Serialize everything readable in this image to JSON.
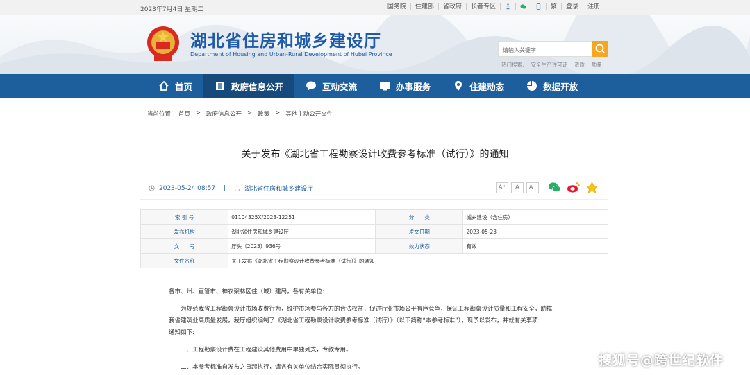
{
  "topbar": {
    "date": "2023年7月4日 星期二",
    "links": [
      "国务院",
      "住建部",
      "省政府",
      "长者专区"
    ],
    "icons": [
      "accessibility-icon",
      "wechat-icon",
      "mobile-icon"
    ],
    "lang": "繁",
    "login": "登录",
    "register": "注册"
  },
  "header": {
    "title": "湖北省住房和城乡建设厅",
    "subtitle": "Department of Housing and Urban-Rural Development of Hubei Province",
    "search_placeholder": "请输入关键字",
    "hot_label": "热门搜索:",
    "hot_items": [
      "安全生产许可证",
      "资质",
      "质量"
    ]
  },
  "nav": {
    "items": [
      {
        "label": "首页",
        "icon": "home-icon"
      },
      {
        "label": "政府信息公开",
        "icon": "document-icon",
        "active": true
      },
      {
        "label": "互动交流",
        "icon": "chat-icon"
      },
      {
        "label": "办事服务",
        "icon": "monitor-icon"
      },
      {
        "label": "住建动态",
        "icon": "location-icon"
      },
      {
        "label": "数据开放",
        "icon": "pie-chart-icon"
      }
    ]
  },
  "breadcrumb": {
    "label": "当前位置:",
    "items": [
      "首页",
      "政府信息公开",
      "政策",
      "其他主动公开文件"
    ],
    "sep": ">"
  },
  "article": {
    "title": "关于发布《湖北省工程勘察设计收费参考标准（试行）》的通知",
    "datetime": "2023-05-24 08:57",
    "sep": "|",
    "source": "湖北省住房和城乡建设厅",
    "font_buttons": [
      "A⁺",
      "A",
      "A⁻"
    ],
    "share_icons": [
      "wechat-share-icon",
      "weibo-share-icon",
      "favorite-star-icon"
    ]
  },
  "info_table": {
    "rows": [
      {
        "k1": "索 引 号",
        "v1": "01104325X/2023-12251",
        "k2": "分　　类",
        "v2": "城乡建设（含住房）"
      },
      {
        "k1": "发布机构",
        "v1": "湖北省住房和城乡建设厅",
        "k2": "发文日期",
        "v2": "2023-05-23"
      },
      {
        "k1": "文　　号",
        "v1": "厅头〔2023〕936号",
        "k2": "效力状态",
        "v2": "有效"
      },
      {
        "k1": "文件名称",
        "v1": "关于发布《湖北省工程勘察设计收费参考标准（试行）》的通知"
      }
    ]
  },
  "body": {
    "salutation": "各市、州、直管市、神农架林区住（城）建局，各有关单位:",
    "para1_line1": "为规范我省工程勘察设计市场收费行为，维护市场参与各方的合法权益，促进行业市场公平有序竞争，保证工程勘察设计质量和工程安全，助推",
    "para1_line2": "我省建筑业高质量发展，我厅组织编制了《湖北省工程勘察设计收费参考标准（试行）》（以下简称“本参考标准”），现予以发布，并就有关事项",
    "para1_line3": "通知如下:",
    "item1": "一、工程勘察设计费在工程建设其他费用中单独列支，专款专用。",
    "item2": "二、本参考标准自发布之日起执行，请各有关单位结合实际贯彻执行。"
  },
  "watermark": "搜狐号@跨世纪软件",
  "colors": {
    "nav": "#1d5e9c",
    "nav_active": "#164a7d",
    "accent": "#f5a623",
    "title_blue": "#1e5aa8"
  }
}
